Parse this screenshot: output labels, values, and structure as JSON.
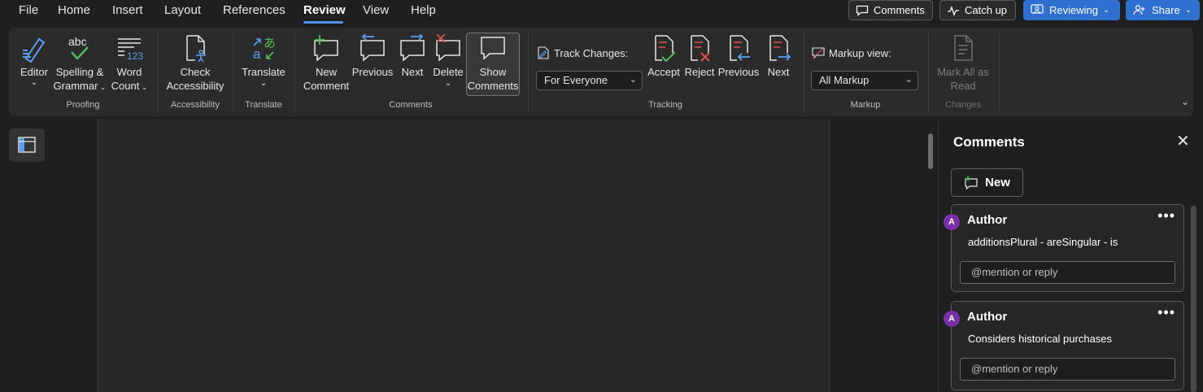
{
  "menu": {
    "items": [
      "File",
      "Home",
      "Insert",
      "Layout",
      "References",
      "Review",
      "View",
      "Help"
    ],
    "active": "Review"
  },
  "top_buttons": {
    "comments": "Comments",
    "catch_up": "Catch up",
    "reviewing": "Reviewing",
    "share": "Share"
  },
  "ribbon": {
    "proofing": {
      "editor": "Editor",
      "spelling_line1": "Spelling &",
      "spelling_line2": "Grammar",
      "spelling_icon_text": "abc",
      "word_count_line1": "Word",
      "word_count_line2": "Count",
      "word_count_icon_text": "123",
      "label": "Proofing"
    },
    "accessibility": {
      "check_line1": "Check",
      "check_line2": "Accessibility",
      "label": "Accessibility"
    },
    "translate": {
      "translate": "Translate",
      "label": "Translate"
    },
    "comments": {
      "new_line1": "New",
      "new_line2": "Comment",
      "previous": "Previous",
      "next": "Next",
      "delete": "Delete",
      "show_line1": "Show",
      "show_line2": "Comments",
      "label": "Comments"
    },
    "tracking": {
      "track_changes_label": "Track Changes:",
      "track_changes_value": "For Everyone",
      "accept": "Accept",
      "reject": "Reject",
      "previous": "Previous",
      "next": "Next",
      "label": "Tracking"
    },
    "markup": {
      "markup_view_label": "Markup view:",
      "markup_view_value": "All Markup",
      "label": "Markup"
    },
    "changes": {
      "mark_all_line1": "Mark All as",
      "mark_all_line2": "Read",
      "label": "Changes"
    }
  },
  "comments_pane": {
    "title": "Comments",
    "new_button": "New",
    "threads": [
      {
        "avatar": "A",
        "author": "Author",
        "text": "additionsPlural - areSingular - is",
        "reply_placeholder": "@mention or reply"
      },
      {
        "avatar": "A",
        "author": "Author",
        "text": "Considers historical purchases",
        "reply_placeholder": "@mention or reply"
      }
    ]
  },
  "colors": {
    "accent_blue": "#2f6fd0",
    "avatar_purple": "#7a2fa6",
    "background": "#1f1f1f",
    "ribbon": "#2b2b2b"
  }
}
